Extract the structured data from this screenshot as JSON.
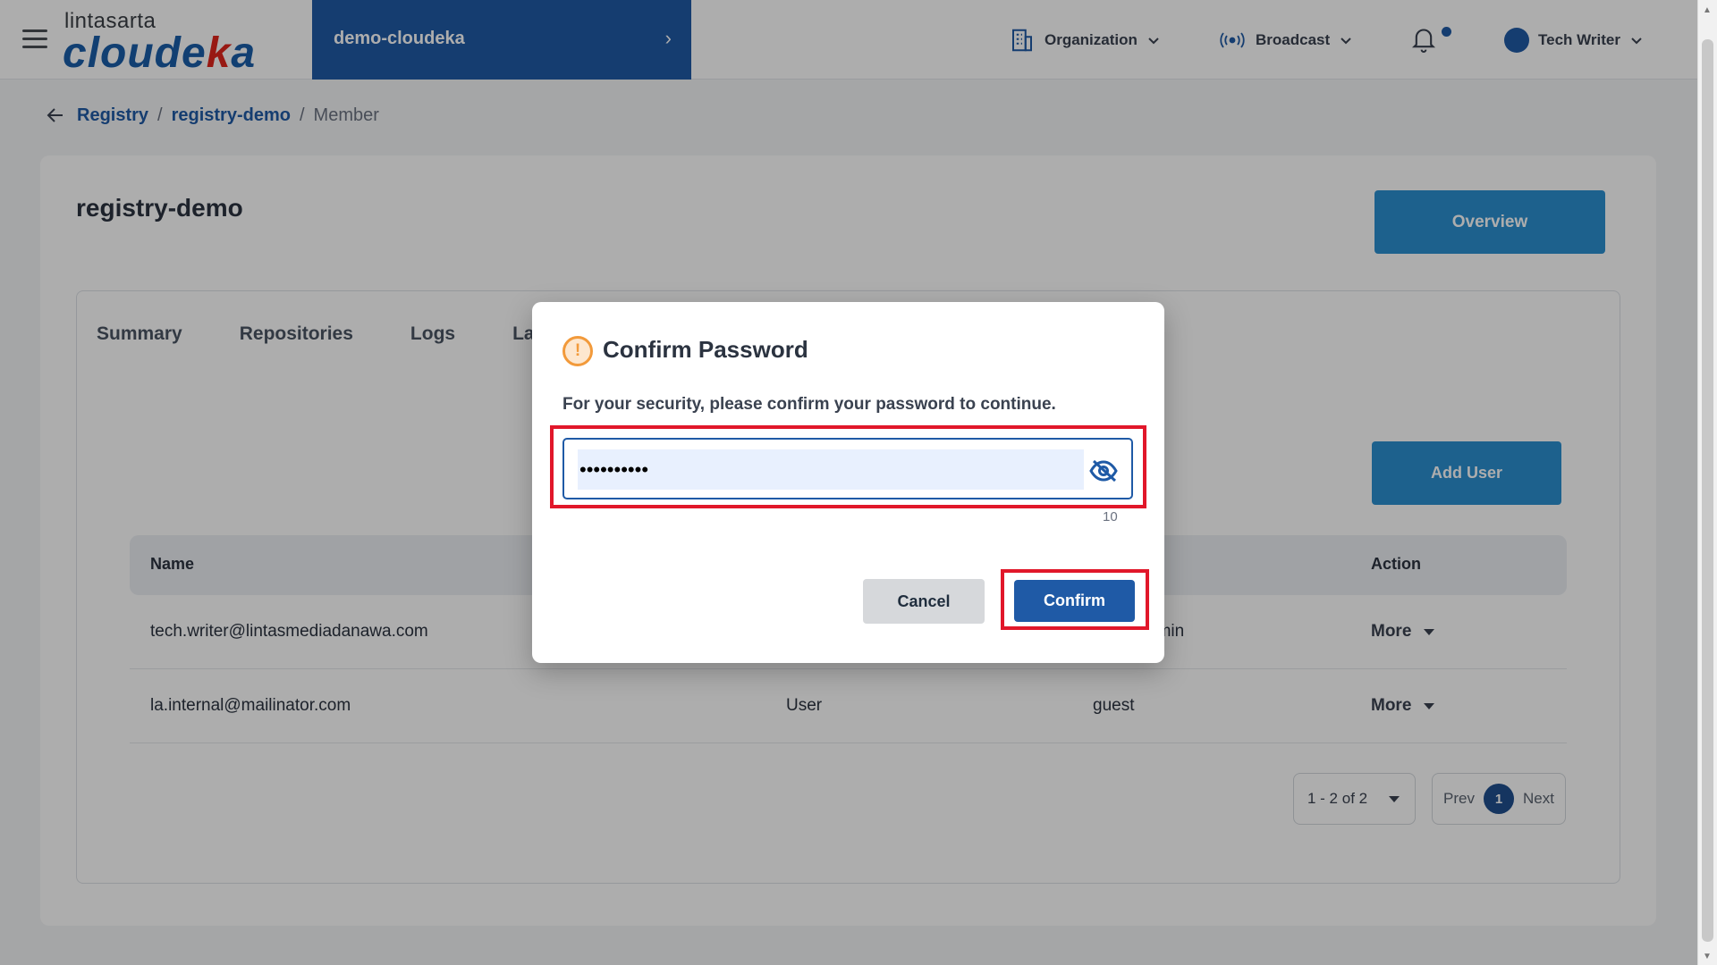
{
  "brand": {
    "top": "lintasarta",
    "main_a": "cloude",
    "main_b": "k",
    "main_c": "a"
  },
  "project": {
    "name": "demo-cloudeka",
    "chevron": "›"
  },
  "header": {
    "organization": "Organization",
    "broadcast": "Broadcast",
    "user": "Tech Writer"
  },
  "breadcrumb": {
    "items": [
      "Registry",
      "registry-demo",
      "Member"
    ],
    "separator": "/"
  },
  "page": {
    "title": "registry-demo",
    "overview_label": "Overview"
  },
  "tabs": [
    "Summary",
    "Repositories",
    "Logs",
    "Labe"
  ],
  "add_user_label": "Add User",
  "table": {
    "headers": {
      "name": "Name",
      "action": "Action"
    },
    "rows": [
      {
        "name": "tech.writer@lintasmediadanawa.com",
        "type": "",
        "role": "dmin",
        "action": "More"
      },
      {
        "name": "la.internal@mailinator.com",
        "type": "User",
        "role": "guest",
        "action": "More"
      }
    ]
  },
  "pagination": {
    "range": "1 - 2 of 2",
    "prev": "Prev",
    "page": "1",
    "next": "Next"
  },
  "modal": {
    "icon": "!",
    "title": "Confirm Password",
    "message": "For your security, please confirm your password to continue.",
    "password_value": "••••••••••",
    "char_count": "10",
    "cancel_label": "Cancel",
    "confirm_label": "Confirm"
  },
  "colors": {
    "primary": "#1f5aa6",
    "accent": "#2c8fd0",
    "highlight": "#e1172a",
    "warning": "#f29a3b"
  }
}
